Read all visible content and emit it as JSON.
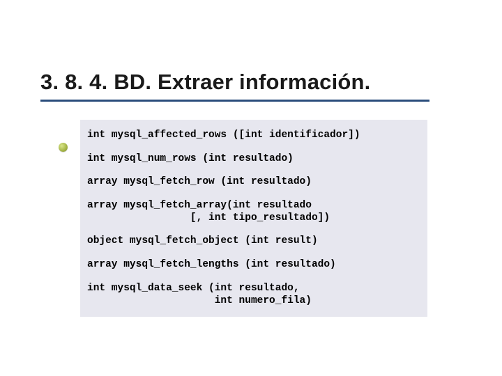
{
  "title": "3. 8. 4. BD. Extraer información.",
  "code": {
    "lines": [
      "int mysql_affected_rows ([int identificador])",
      "int mysql_num_rows (int resultado)",
      "array mysql_fetch_row (int resultado)",
      "array mysql_fetch_array(int resultado\n                 [, int tipo_resultado])",
      "object mysql_fetch_object (int result)",
      "array mysql_fetch_lengths (int resultado)",
      "int mysql_data_seek (int resultado,\n                     int numero_fila)"
    ]
  }
}
